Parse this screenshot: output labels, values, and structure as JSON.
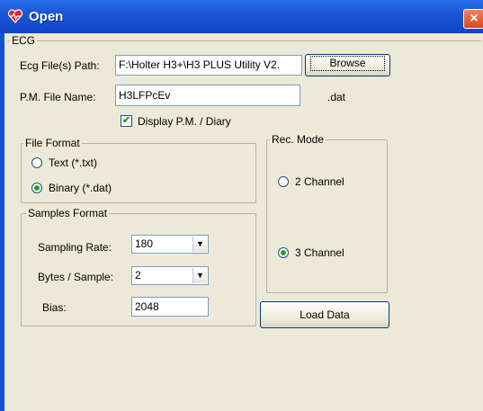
{
  "window": {
    "title": "Open",
    "close_label": "×"
  },
  "ecg": {
    "group_label": "ECG",
    "file_path_label": "Ecg File(s) Path:",
    "file_path_value": "F:\\Holter H3+\\H3 PLUS Utility V2.",
    "browse_label": "Browse",
    "pm_file_label": "P.M. File Name:",
    "pm_file_value": "H3LFPcEv",
    "pm_ext": ".dat",
    "display_pm_label": "Display P.M. / Diary",
    "display_pm_checked": true
  },
  "file_format": {
    "group_label": "File Format",
    "options": [
      {
        "label": "Text (*.txt)",
        "selected": false
      },
      {
        "label": "Binary (*.dat)",
        "selected": true
      }
    ]
  },
  "samples_format": {
    "group_label": "Samples Format",
    "sampling_rate_label": "Sampling Rate:",
    "sampling_rate_value": "180",
    "bytes_sample_label": "Bytes / Sample:",
    "bytes_sample_value": "2",
    "bias_label": "Bias:",
    "bias_value": "2048"
  },
  "rec_mode": {
    "group_label": "Rec. Mode",
    "options": [
      {
        "label": "2 Channel",
        "selected": false
      },
      {
        "label": "3 Channel",
        "selected": true
      }
    ]
  },
  "load_data_label": "Load Data"
}
